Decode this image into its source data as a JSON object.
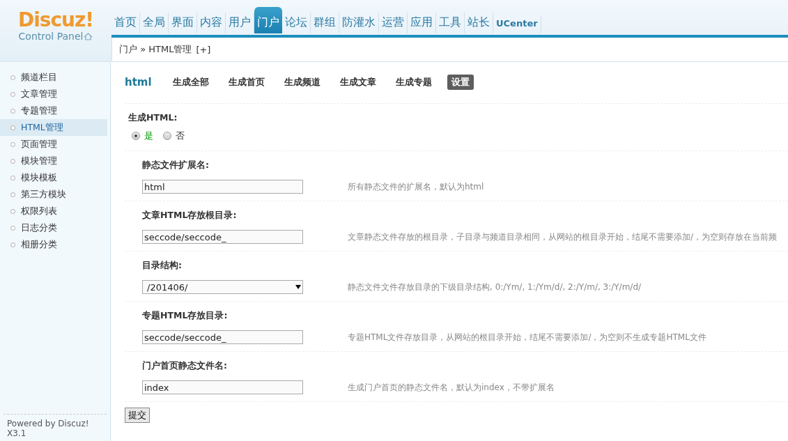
{
  "logo": {
    "title": "Discuz!",
    "subtitle": "Control Panel"
  },
  "nav": [
    {
      "label": "首页",
      "selected": false
    },
    {
      "label": "全局",
      "selected": false
    },
    {
      "label": "界面",
      "selected": false
    },
    {
      "label": "内容",
      "selected": false
    },
    {
      "label": "用户",
      "selected": false
    },
    {
      "label": "门户",
      "selected": true
    },
    {
      "label": "论坛",
      "selected": false
    },
    {
      "label": "群组",
      "selected": false
    },
    {
      "label": "防灌水",
      "selected": false
    },
    {
      "label": "运营",
      "selected": false
    },
    {
      "label": "应用",
      "selected": false
    },
    {
      "label": "工具",
      "selected": false
    },
    {
      "label": "站长",
      "selected": false
    },
    {
      "label": "UCenter",
      "selected": false
    }
  ],
  "breadcrumb": {
    "text": "门户 » HTML管理",
    "add": "[+]"
  },
  "sidebar": {
    "items": [
      {
        "label": "频道栏目",
        "selected": false
      },
      {
        "label": "文章管理",
        "selected": false
      },
      {
        "label": "专题管理",
        "selected": false
      },
      {
        "label": "HTML管理",
        "selected": true
      },
      {
        "label": "页面管理",
        "selected": false
      },
      {
        "label": "模块管理",
        "selected": false
      },
      {
        "label": "模块模板",
        "selected": false
      },
      {
        "label": "第三方模块",
        "selected": false
      },
      {
        "label": "权限列表",
        "selected": false
      },
      {
        "label": "日志分类",
        "selected": false
      },
      {
        "label": "相册分类",
        "selected": false
      }
    ],
    "footer": "Powered by Discuz! X3.1"
  },
  "content": {
    "title": "html",
    "tabs": [
      {
        "label": "生成全部",
        "selected": false
      },
      {
        "label": "生成首页",
        "selected": false
      },
      {
        "label": "生成频道",
        "selected": false
      },
      {
        "label": "生成文章",
        "selected": false
      },
      {
        "label": "生成专题",
        "selected": false
      },
      {
        "label": "设置",
        "selected": true
      }
    ],
    "generate": {
      "label": "生成HTML:",
      "options": [
        {
          "label": "是",
          "selected": true
        },
        {
          "label": "否",
          "selected": false
        }
      ]
    },
    "fields": [
      {
        "label": "静态文件扩展名:",
        "kind": "text",
        "value": "html",
        "hint": "所有静态文件的扩展名，默认为html"
      },
      {
        "label": "文章HTML存放根目录:",
        "kind": "text",
        "value": "seccode/seccode_",
        "hint": "文章静态文件存放的根目录，子目录与频道目录相同，从网站的根目录开始，结尾不需要添加/，为空则存放在当前频"
      },
      {
        "label": "目录结构:",
        "kind": "select",
        "value": "/201406/",
        "hint": "静态文件文件存放目录的下级目录结构, 0:/Ym/, 1:/Ym/d/, 2:/Y/m/, 3:/Y/m/d/"
      },
      {
        "label": "专题HTML存放目录:",
        "kind": "text",
        "value": "seccode/seccode_",
        "hint": "专题HTML文件存放目录，从网站的根目录开始，结尾不需要添加/，为空则不生成专题HTML文件"
      },
      {
        "label": "门户首页静态文件名:",
        "kind": "text",
        "value": "index",
        "hint": "生成门户首页的静态文件名，默认为index，不带扩展名"
      }
    ],
    "submit": "提交"
  }
}
